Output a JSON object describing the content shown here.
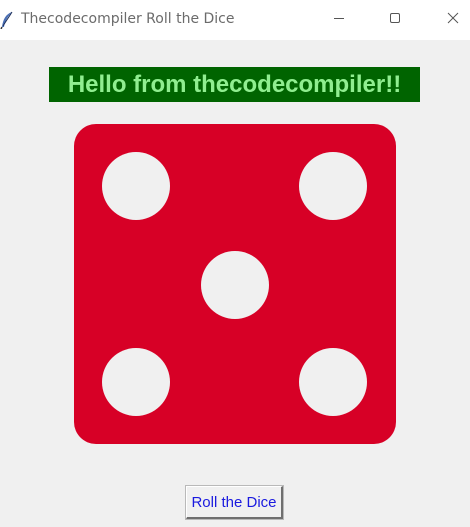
{
  "window": {
    "title": "Thecodecompiler Roll the Dice",
    "controls": {
      "minimize_icon": "minimize-icon",
      "maximize_icon": "maximize-icon",
      "close_icon": "close-icon"
    },
    "app_icon": "feather-icon"
  },
  "greeting": {
    "text": "Hello from thecodecompiler!!",
    "background": "#006400",
    "color": "#90ee90"
  },
  "dice": {
    "face_value": 5,
    "color": "#d70026",
    "pip_color": "#f0f0f0"
  },
  "roll_button": {
    "label": "Roll the Dice",
    "color": "#1a1adf"
  }
}
